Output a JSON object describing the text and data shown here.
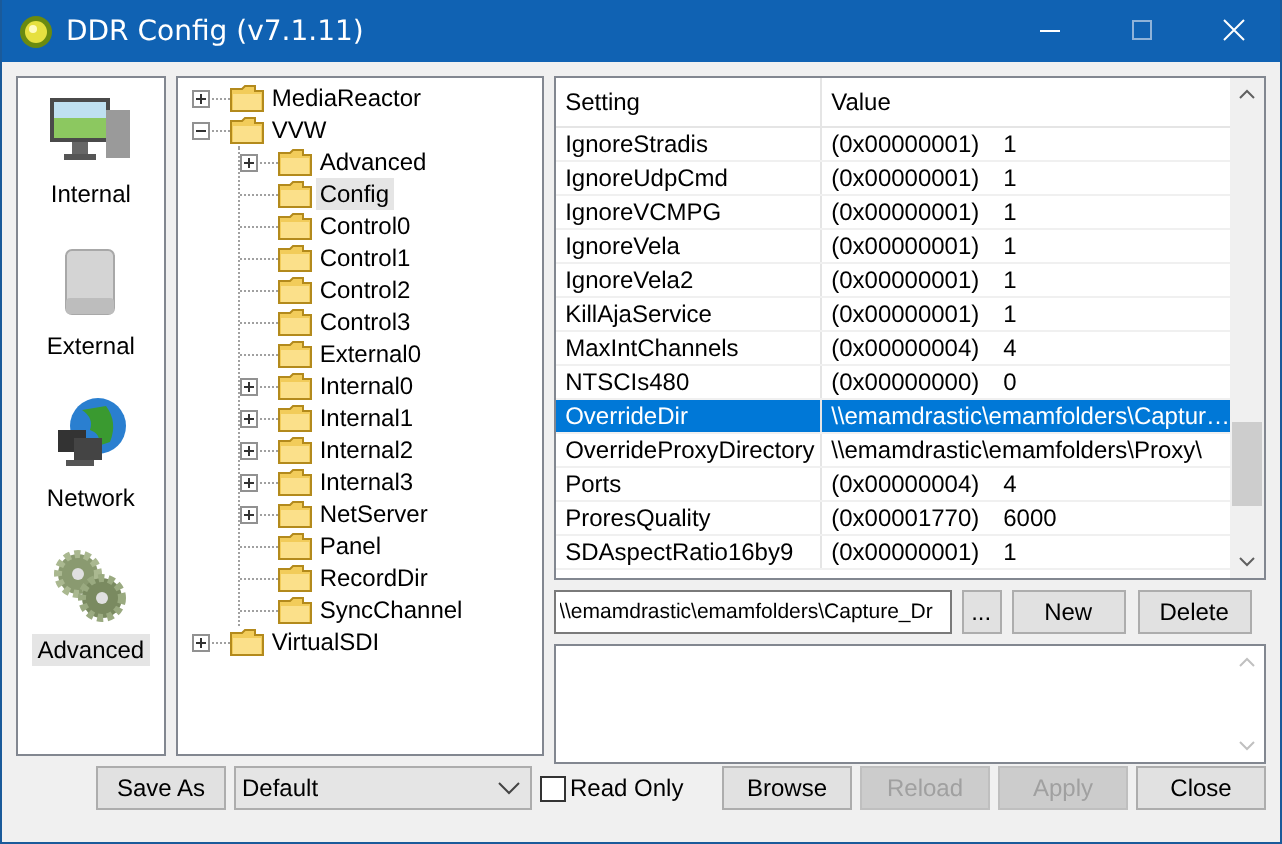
{
  "window": {
    "title": "DDR Config (v7.1.11)"
  },
  "sidebar": {
    "items": [
      {
        "label": "Internal",
        "selected": false
      },
      {
        "label": "External",
        "selected": false
      },
      {
        "label": "Network",
        "selected": false
      },
      {
        "label": "Advanced",
        "selected": true
      }
    ]
  },
  "tree": [
    {
      "label": "MediaReactor",
      "kind": "branch",
      "expanded": false,
      "selected": false
    },
    {
      "label": "VVW",
      "kind": "branch",
      "expanded": true,
      "selected": false,
      "children": [
        {
          "label": "Advanced",
          "kind": "branch",
          "expanded": false,
          "selected": false
        },
        {
          "label": "Config",
          "kind": "leaf",
          "selected": true
        },
        {
          "label": "Control0",
          "kind": "leaf",
          "selected": false
        },
        {
          "label": "Control1",
          "kind": "leaf",
          "selected": false
        },
        {
          "label": "Control2",
          "kind": "leaf",
          "selected": false
        },
        {
          "label": "Control3",
          "kind": "leaf",
          "selected": false
        },
        {
          "label": "External0",
          "kind": "leaf",
          "selected": false
        },
        {
          "label": "Internal0",
          "kind": "branch",
          "expanded": false,
          "selected": false
        },
        {
          "label": "Internal1",
          "kind": "branch",
          "expanded": false,
          "selected": false
        },
        {
          "label": "Internal2",
          "kind": "branch",
          "expanded": false,
          "selected": false
        },
        {
          "label": "Internal3",
          "kind": "branch",
          "expanded": false,
          "selected": false
        },
        {
          "label": "NetServer",
          "kind": "branch",
          "expanded": false,
          "selected": false
        },
        {
          "label": "Panel",
          "kind": "leaf",
          "selected": false
        },
        {
          "label": "RecordDir",
          "kind": "leaf",
          "selected": false
        },
        {
          "label": "SyncChannel",
          "kind": "leaf",
          "selected": false
        }
      ]
    },
    {
      "label": "VirtualSDI",
      "kind": "branch",
      "expanded": false,
      "selected": false
    }
  ],
  "table": {
    "columns": [
      "Setting",
      "Value"
    ],
    "rows": [
      {
        "setting": "IgnoreStradis",
        "hex": "(0x00000001)",
        "value": "1",
        "selected": false
      },
      {
        "setting": "IgnoreUdpCmd",
        "hex": "(0x00000001)",
        "value": "1",
        "selected": false
      },
      {
        "setting": "IgnoreVCMPG",
        "hex": "(0x00000001)",
        "value": "1",
        "selected": false
      },
      {
        "setting": "IgnoreVela",
        "hex": "(0x00000001)",
        "value": "1",
        "selected": false
      },
      {
        "setting": "IgnoreVela2",
        "hex": "(0x00000001)",
        "value": "1",
        "selected": false
      },
      {
        "setting": "KillAjaService",
        "hex": "(0x00000001)",
        "value": "1",
        "selected": false
      },
      {
        "setting": "MaxIntChannels",
        "hex": "(0x00000004)",
        "value": "4",
        "selected": false
      },
      {
        "setting": "NTSCIs480",
        "hex": "(0x00000000)",
        "value": "0",
        "selected": false
      },
      {
        "setting": "OverrideDir",
        "value": "\\\\emamdrastic\\emamfolders\\Captur…",
        "selected": true
      },
      {
        "setting": "OverrideProxyDirectory",
        "value": "\\\\emamdrastic\\emamfolders\\Proxy\\",
        "selected": false
      },
      {
        "setting": "Ports",
        "hex": "(0x00000004)",
        "value": "4",
        "selected": false
      },
      {
        "setting": "ProresQuality",
        "hex": "(0x00001770)",
        "value": "6000",
        "selected": false
      },
      {
        "setting": "SDAspectRatio16by9",
        "hex": "(0x00000001)",
        "value": "1",
        "selected": false
      }
    ]
  },
  "editor": {
    "value": "\\\\emamdrastic\\emamfolders\\Capture_Dr",
    "browse_label": "...",
    "buttons": [
      {
        "label": "New",
        "disabled": false
      },
      {
        "label": "Delete",
        "disabled": false
      }
    ]
  },
  "footer": {
    "save_as": "Save As",
    "profile": "Default",
    "read_only": {
      "label": "Read Only",
      "checked": false
    },
    "buttons": [
      {
        "label": "Browse",
        "disabled": false
      },
      {
        "label": "Reload",
        "disabled": true
      },
      {
        "label": "Apply",
        "disabled": true
      },
      {
        "label": "Close",
        "disabled": false
      }
    ]
  }
}
